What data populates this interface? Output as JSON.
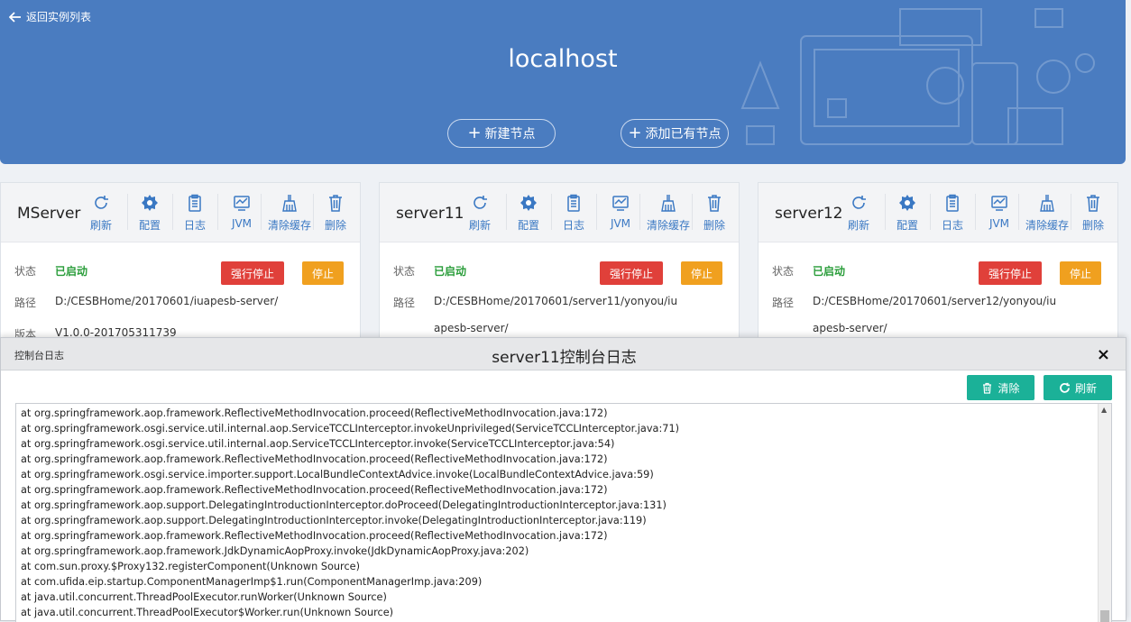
{
  "header": {
    "back_label": "返回实例列表",
    "host_title": "localhost",
    "new_node_label": "新建节点",
    "add_existing_label": "添加已有节点"
  },
  "toolbar_labels": {
    "refresh": "刷新",
    "config": "配置",
    "log": "日志",
    "jvm": "JVM",
    "clear_cache": "清除缓存",
    "delete": "删除"
  },
  "cards": [
    {
      "name": "MServer",
      "status_label": "状态",
      "status": "已启动",
      "force_stop": "强行停止",
      "stop": "停止",
      "path_label": "路径",
      "path_line1": "D:/CESBHome/20170601/iuapesb-server/",
      "path_line2": "",
      "version_label": "版本",
      "version": "V1.0.0-201705311739"
    },
    {
      "name": "server11",
      "status_label": "状态",
      "status": "已启动",
      "force_stop": "强行停止",
      "stop": "停止",
      "path_label": "路径",
      "path_line1": "D:/CESBHome/20170601/server11/yonyou/iu",
      "path_line2": "apesb-server/"
    },
    {
      "name": "server12",
      "status_label": "状态",
      "status": "已启动",
      "force_stop": "强行停止",
      "stop": "停止",
      "path_label": "路径",
      "path_line1": "D:/CESBHome/20170601/server12/yonyou/iu",
      "path_line2": "apesb-server/"
    }
  ],
  "modal": {
    "tag": "控制台日志",
    "title": "server11控制台日志",
    "close": "×",
    "clear_label": "清除",
    "refresh_label": "刷新",
    "log_lines": [
      "at org.springframework.aop.framework.ReflectiveMethodInvocation.proceed(ReflectiveMethodInvocation.java:172)",
      "at org.springframework.osgi.service.util.internal.aop.ServiceTCCLInterceptor.invokeUnprivileged(ServiceTCCLInterceptor.java:71)",
      "at org.springframework.osgi.service.util.internal.aop.ServiceTCCLInterceptor.invoke(ServiceTCCLInterceptor.java:54)",
      "at org.springframework.aop.framework.ReflectiveMethodInvocation.proceed(ReflectiveMethodInvocation.java:172)",
      "at org.springframework.osgi.service.importer.support.LocalBundleContextAdvice.invoke(LocalBundleContextAdvice.java:59)",
      "at org.springframework.aop.framework.ReflectiveMethodInvocation.proceed(ReflectiveMethodInvocation.java:172)",
      "at org.springframework.aop.support.DelegatingIntroductionInterceptor.doProceed(DelegatingIntroductionInterceptor.java:131)",
      "at org.springframework.aop.support.DelegatingIntroductionInterceptor.invoke(DelegatingIntroductionInterceptor.java:119)",
      "at org.springframework.aop.framework.ReflectiveMethodInvocation.proceed(ReflectiveMethodInvocation.java:172)",
      "at org.springframework.aop.framework.JdkDynamicAopProxy.invoke(JdkDynamicAopProxy.java:202)",
      "at com.sun.proxy.$Proxy132.registerComponent(Unknown Source)",
      "at com.ufida.eip.startup.ComponentManagerImp$1.run(ComponentManagerImp.java:209)",
      "at java.util.concurrent.ThreadPoolExecutor.runWorker(Unknown Source)",
      "at java.util.concurrent.ThreadPoolExecutor$Worker.run(Unknown Source)"
    ]
  },
  "colors": {
    "banner": "#4a7cc0",
    "accent_blue": "#3a78c3",
    "status_green": "#2a9d3a",
    "danger": "#e0403a",
    "warning": "#f0a01f",
    "teal": "#1bb198"
  }
}
